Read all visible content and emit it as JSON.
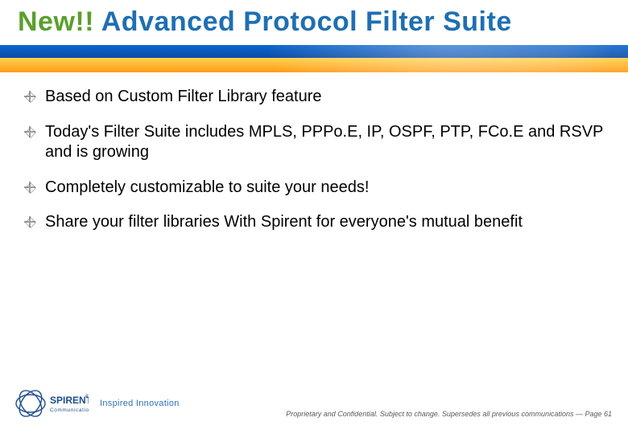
{
  "title": {
    "new_prefix": "New!!",
    "rest": " Advanced Protocol Filter Suite"
  },
  "bullets": [
    "Based on Custom Filter Library feature",
    "Today's Filter Suite includes MPLS, PPPo.E, IP, OSPF, PTP, FCo.E and RSVP and is growing",
    "Completely customizable to suite your needs!",
    "Share your filter libraries With Spirent for everyone's mutual benefit"
  ],
  "logo": {
    "brand": "SPIRENT",
    "sub": "Communications",
    "mark": "®",
    "tagline": "Inspired Innovation"
  },
  "footer": {
    "text": "Proprietary and Confidential. Subject to change. Supersedes all previous communications — Page 61"
  },
  "colors": {
    "title_main": "#1f6fb3",
    "title_new": "#5aa02c",
    "brand": "#1e4e8c"
  }
}
